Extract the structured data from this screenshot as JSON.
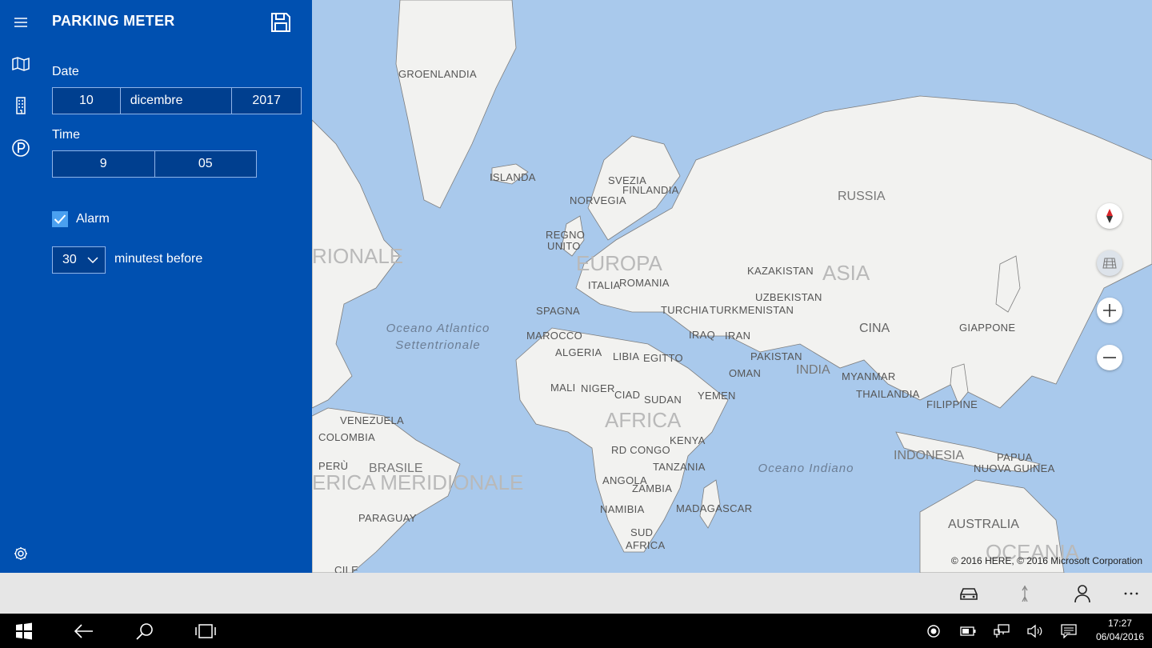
{
  "app": {
    "title": "PARKING METER"
  },
  "form": {
    "date_label": "Date",
    "date": {
      "day": "10",
      "month": "dicembre",
      "year": "2017"
    },
    "time_label": "Time",
    "time": {
      "hour": "9",
      "minute": "05"
    },
    "alarm_label": "Alarm",
    "alarm_checked": true,
    "minutes_value": "30",
    "minutes_label": "minutest before"
  },
  "map": {
    "labels": {
      "groenlandia": "GROENLANDIA",
      "islanda": "ISLANDA",
      "svezia": "SVEZIA",
      "finlandia": "FINLANDIA",
      "norvegia": "NORVEGIA",
      "russia": "RUSSIA",
      "regno_unito_1": "REGNO",
      "regno_unito_2": "UNITO",
      "europa": "EUROPA",
      "italia": "ITALIA",
      "romania": "ROMANIA",
      "kazakistan": "KAZAKISTAN",
      "asia": "ASIA",
      "uzbekistan": "UZBEKISTAN",
      "turkmenistan": "TURKMENISTAN",
      "turchia": "TURCHIA",
      "spagna": "SPAGNA",
      "marocco": "MAROCCO",
      "algeria": "ALGERIA",
      "libia": "LIBIA",
      "egitto": "EGITTO",
      "iraq": "IRAQ",
      "iran": "IRAN",
      "pakistan": "PAKISTAN",
      "cina": "CINA",
      "giappone": "GIAPPONE",
      "india": "INDIA",
      "oman": "OMAN",
      "myanmar": "MYANMAR",
      "thailandia": "THAILANDIA",
      "filippine": "FILIPPINE",
      "mali": "MALI",
      "niger": "NIGER",
      "ciad": "CIAD",
      "sudan": "SUDAN",
      "yemen": "YEMEN",
      "africa": "AFRICA",
      "kenya": "KENYA",
      "rd_congo": "RD CONGO",
      "tanzania": "TANZANIA",
      "angola": "ANGOLA",
      "zambia": "ZAMBIA",
      "namibia": "NAMIBIA",
      "madagascar": "MADAGASCAR",
      "sud": "SUD",
      "africa_sud": "AFRICA",
      "indonesia": "INDONESIA",
      "papua_1": "PAPUA",
      "papua_2": "NUOVA GUINEA",
      "australia": "AUSTRALIA",
      "oceania": "OCEANIA",
      "venezuela": "VENEZUELA",
      "colombia": "COLOMBIA",
      "peru": "PERÙ",
      "brasile": "BRASILE",
      "sud_america": "ERICA MERIDIONALE",
      "paraguay": "PARAGUAY",
      "cile": "CILE",
      "nord_america": "RIONALE",
      "atlantico_1": "Oceano Atlantico",
      "atlantico_2": "Settentrionale",
      "indiano": "Oceano Indiano"
    },
    "copyright": "© 2016 HERE, © 2016 Microsoft Corporation"
  },
  "taskbar": {
    "time": "17:27",
    "date": "06/04/2016"
  }
}
